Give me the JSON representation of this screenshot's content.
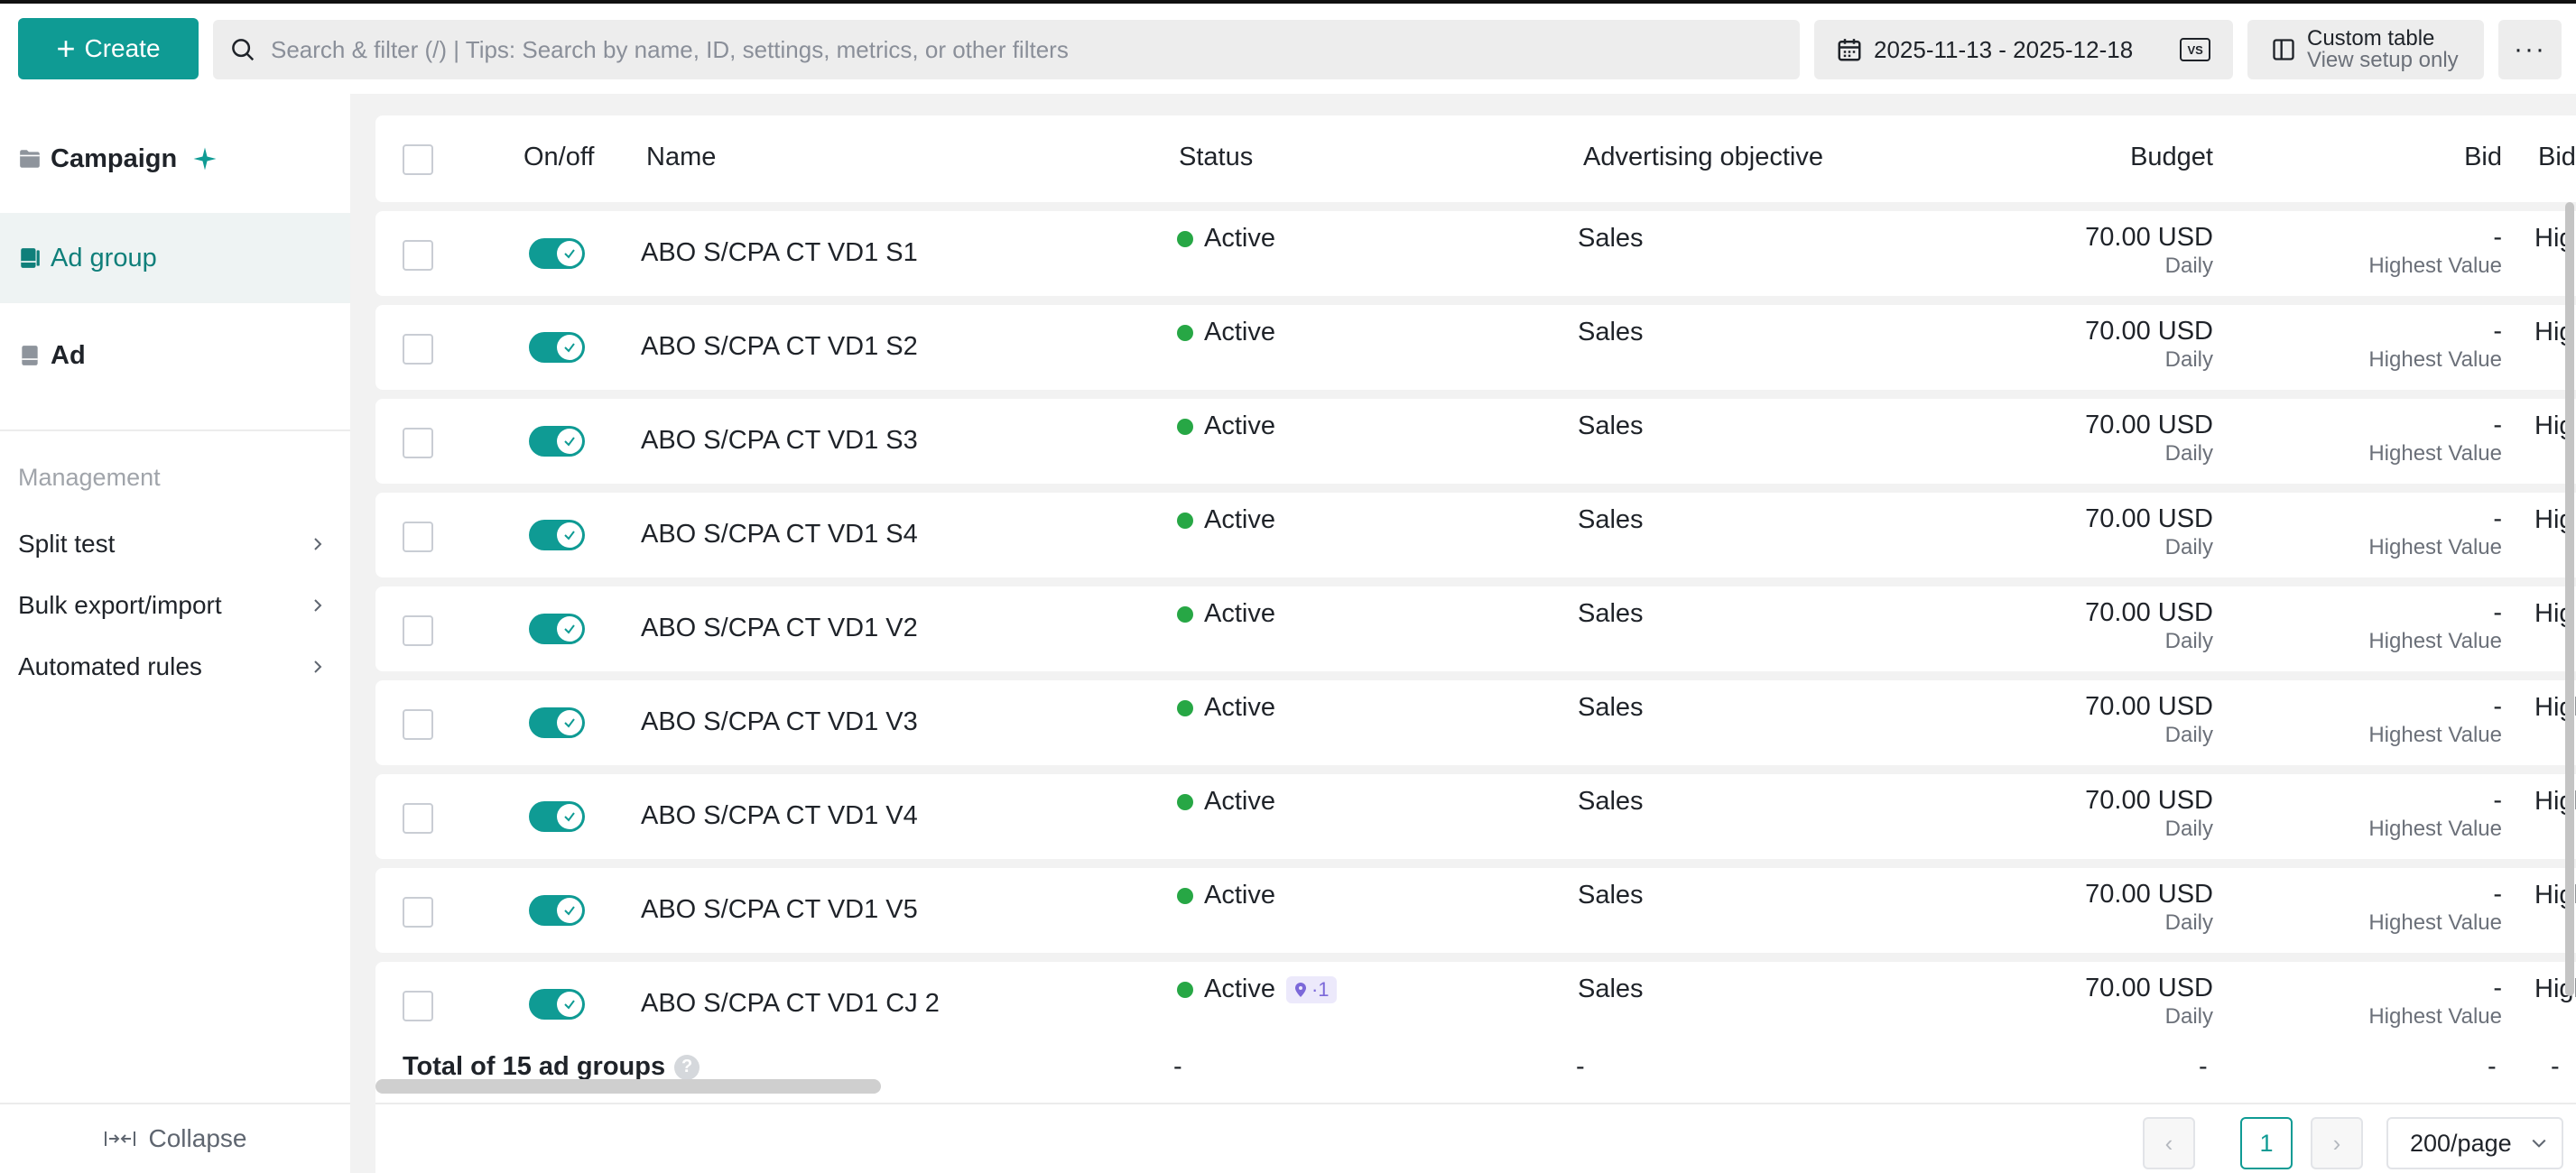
{
  "toolbar": {
    "create_label": "Create",
    "search_placeholder": "Search & filter (/) | Tips: Search by name, ID, settings, metrics, or other filters",
    "date_range": "2025-11-13 - 2025-12-18",
    "vs_label": "VS",
    "custom_table_title": "Custom table",
    "custom_table_sub": "View setup only",
    "more_label": "···"
  },
  "sidebar": {
    "levels": [
      {
        "label": "Campaign"
      },
      {
        "label": "Ad group"
      },
      {
        "label": "Ad"
      }
    ],
    "management_title": "Management",
    "management_items": [
      {
        "label": "Split test"
      },
      {
        "label": "Bulk export/import"
      },
      {
        "label": "Automated rules"
      }
    ],
    "collapse_label": "Collapse"
  },
  "table": {
    "headers": {
      "onoff": "On/off",
      "name": "Name",
      "status": "Status",
      "objective": "Advertising objective",
      "budget": "Budget",
      "bid": "Bid",
      "bid2": "Bid"
    },
    "rows": [
      {
        "name": "ABO S/CPA CT VD1 S1",
        "status": "Active",
        "badge": "",
        "objective": "Sales",
        "budget": "70.00 USD",
        "budget_period": "Daily",
        "bid": "-",
        "bid_strategy": "Highest Value",
        "bid2": "Hig"
      },
      {
        "name": "ABO S/CPA CT VD1 S2",
        "status": "Active",
        "badge": "",
        "objective": "Sales",
        "budget": "70.00 USD",
        "budget_period": "Daily",
        "bid": "-",
        "bid_strategy": "Highest Value",
        "bid2": "Hig"
      },
      {
        "name": "ABO S/CPA CT VD1 S3",
        "status": "Active",
        "badge": "",
        "objective": "Sales",
        "budget": "70.00 USD",
        "budget_period": "Daily",
        "bid": "-",
        "bid_strategy": "Highest Value",
        "bid2": "Hig"
      },
      {
        "name": "ABO S/CPA CT VD1 S4",
        "status": "Active",
        "badge": "",
        "objective": "Sales",
        "budget": "70.00 USD",
        "budget_period": "Daily",
        "bid": "-",
        "bid_strategy": "Highest Value",
        "bid2": "Hig"
      },
      {
        "name": "ABO S/CPA CT VD1 V2",
        "status": "Active",
        "badge": "",
        "objective": "Sales",
        "budget": "70.00 USD",
        "budget_period": "Daily",
        "bid": "-",
        "bid_strategy": "Highest Value",
        "bid2": "Hig"
      },
      {
        "name": "ABO S/CPA CT VD1 V3",
        "status": "Active",
        "badge": "",
        "objective": "Sales",
        "budget": "70.00 USD",
        "budget_period": "Daily",
        "bid": "-",
        "bid_strategy": "Highest Value",
        "bid2": "High"
      },
      {
        "name": "ABO S/CPA CT VD1 V4",
        "status": "Active",
        "badge": "",
        "objective": "Sales",
        "budget": "70.00 USD",
        "budget_period": "Daily",
        "bid": "-",
        "bid_strategy": "Highest Value",
        "bid2": "High"
      },
      {
        "name": "ABO S/CPA CT VD1 V5",
        "status": "Active",
        "badge": "",
        "objective": "Sales",
        "budget": "70.00 USD",
        "budget_period": "Daily",
        "bid": "-",
        "bid_strategy": "Highest Value",
        "bid2": "High"
      },
      {
        "name": "ABO S/CPA CT VD1 CJ 2",
        "status": "Active",
        "badge": "·1",
        "objective": "Sales",
        "budget": "70.00 USD",
        "budget_period": "Daily",
        "bid": "-",
        "bid_strategy": "Highest Value",
        "bid2": "High"
      }
    ],
    "total": {
      "label": "Total of 15 ad groups",
      "status": "-",
      "objective": "-",
      "budget": "-",
      "bid": "-",
      "bid2": "-"
    }
  },
  "pagination": {
    "current_page": "1",
    "page_size": "200/page"
  },
  "colors": {
    "accent": "#0f9b94",
    "active_dot": "#27a745"
  }
}
